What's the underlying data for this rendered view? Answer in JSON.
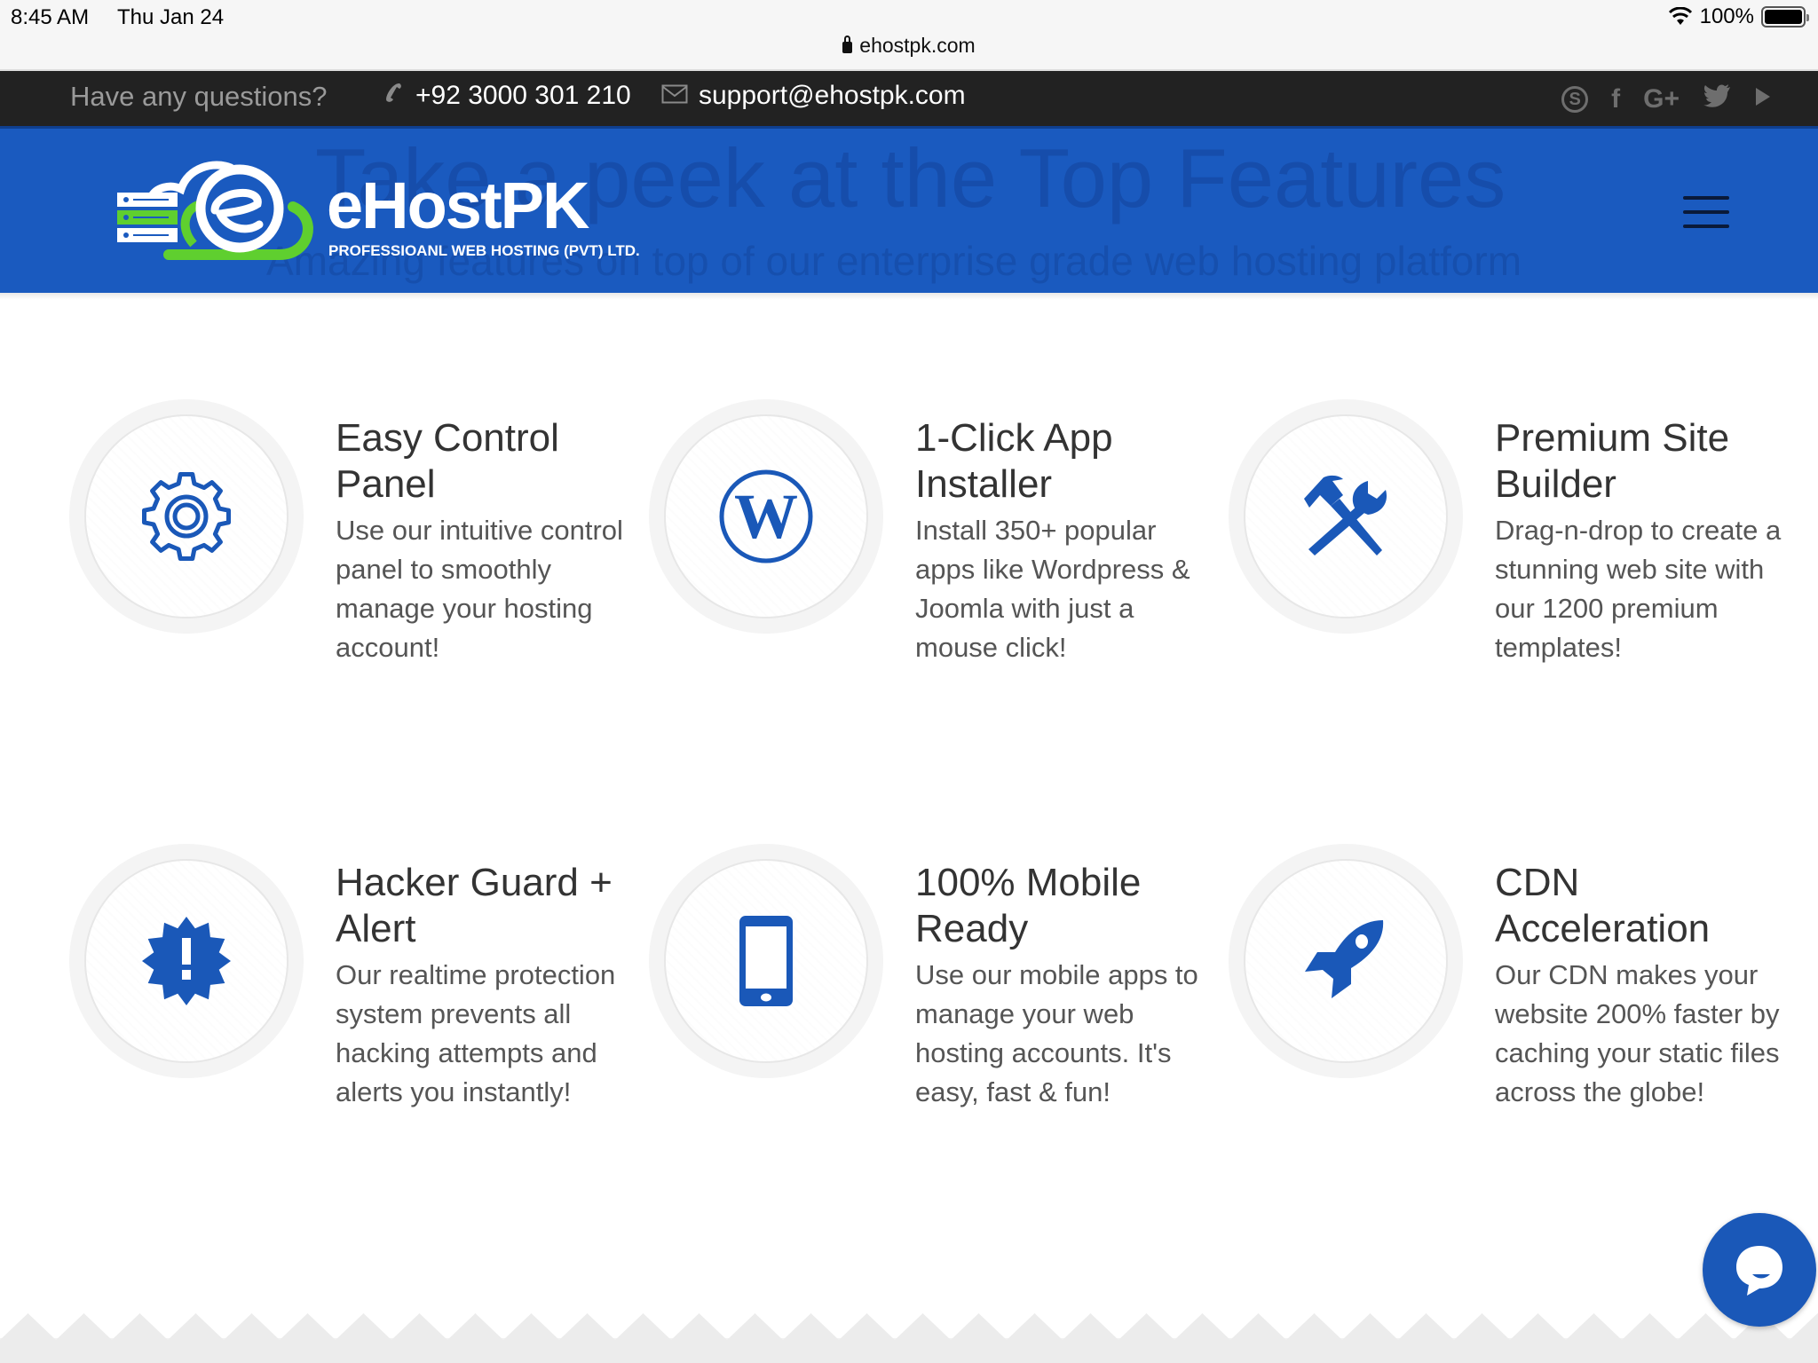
{
  "status_bar": {
    "time": "8:45 AM",
    "date": "Thu Jan 24",
    "battery": "100%",
    "battery_level": 1.0,
    "url": "ehostpk.com"
  },
  "topbar": {
    "question": "Have any questions?",
    "phone": "+92 3000 301 210",
    "email": "support@ehostpk.com",
    "social_icons": [
      "skype-icon",
      "facebook-icon",
      "google-plus-icon",
      "twitter-icon",
      "youtube-icon"
    ],
    "social_glyphs": [
      "S",
      "f",
      "G+",
      "🐦",
      "▶"
    ]
  },
  "header": {
    "logo_text": "eHostPK",
    "logo_tagline": "PROFESSIOANL WEB HOSTING (PVT) LTD.",
    "ghost_title": "Take a peek at the Top Features",
    "ghost_subtitle": "Amazing features on top of our enterprise grade web hosting platform"
  },
  "colors": {
    "brand_blue": "#1a5abf",
    "logo_green": "#5fcf2f",
    "topbar_bg": "#222222",
    "icon_blue": "#1a58b8"
  },
  "features": [
    {
      "icon": "gear-icon",
      "title": "Easy Control Panel",
      "description": "Use our intuitive control panel to smoothly manage your hosting account!"
    },
    {
      "icon": "wordpress-icon",
      "title": "1-Click App Installer",
      "description": "Install 350+ popular apps like Wordpress & Joomla with just a mouse click!"
    },
    {
      "icon": "hammer-wrench-icon",
      "title": "Premium Site Builder",
      "description": "Drag-n-drop to create a stunning web site with our 1200 premium templates!"
    },
    {
      "icon": "alert-badge-icon",
      "title": "Hacker Guard + Alert",
      "description": "Our realtime protection system prevents all hacking attempts and alerts you instantly!"
    },
    {
      "icon": "mobile-phone-icon",
      "title": "100% Mobile Ready",
      "description": "Use our mobile apps to manage your web hosting accounts. It's easy, fast & fun!"
    },
    {
      "icon": "rocket-icon",
      "title": "CDN Acceleration",
      "description": "Our CDN makes your website 200% faster by caching your static files across the globe!"
    }
  ],
  "chat": {
    "icon": "chat-bubble-icon"
  }
}
